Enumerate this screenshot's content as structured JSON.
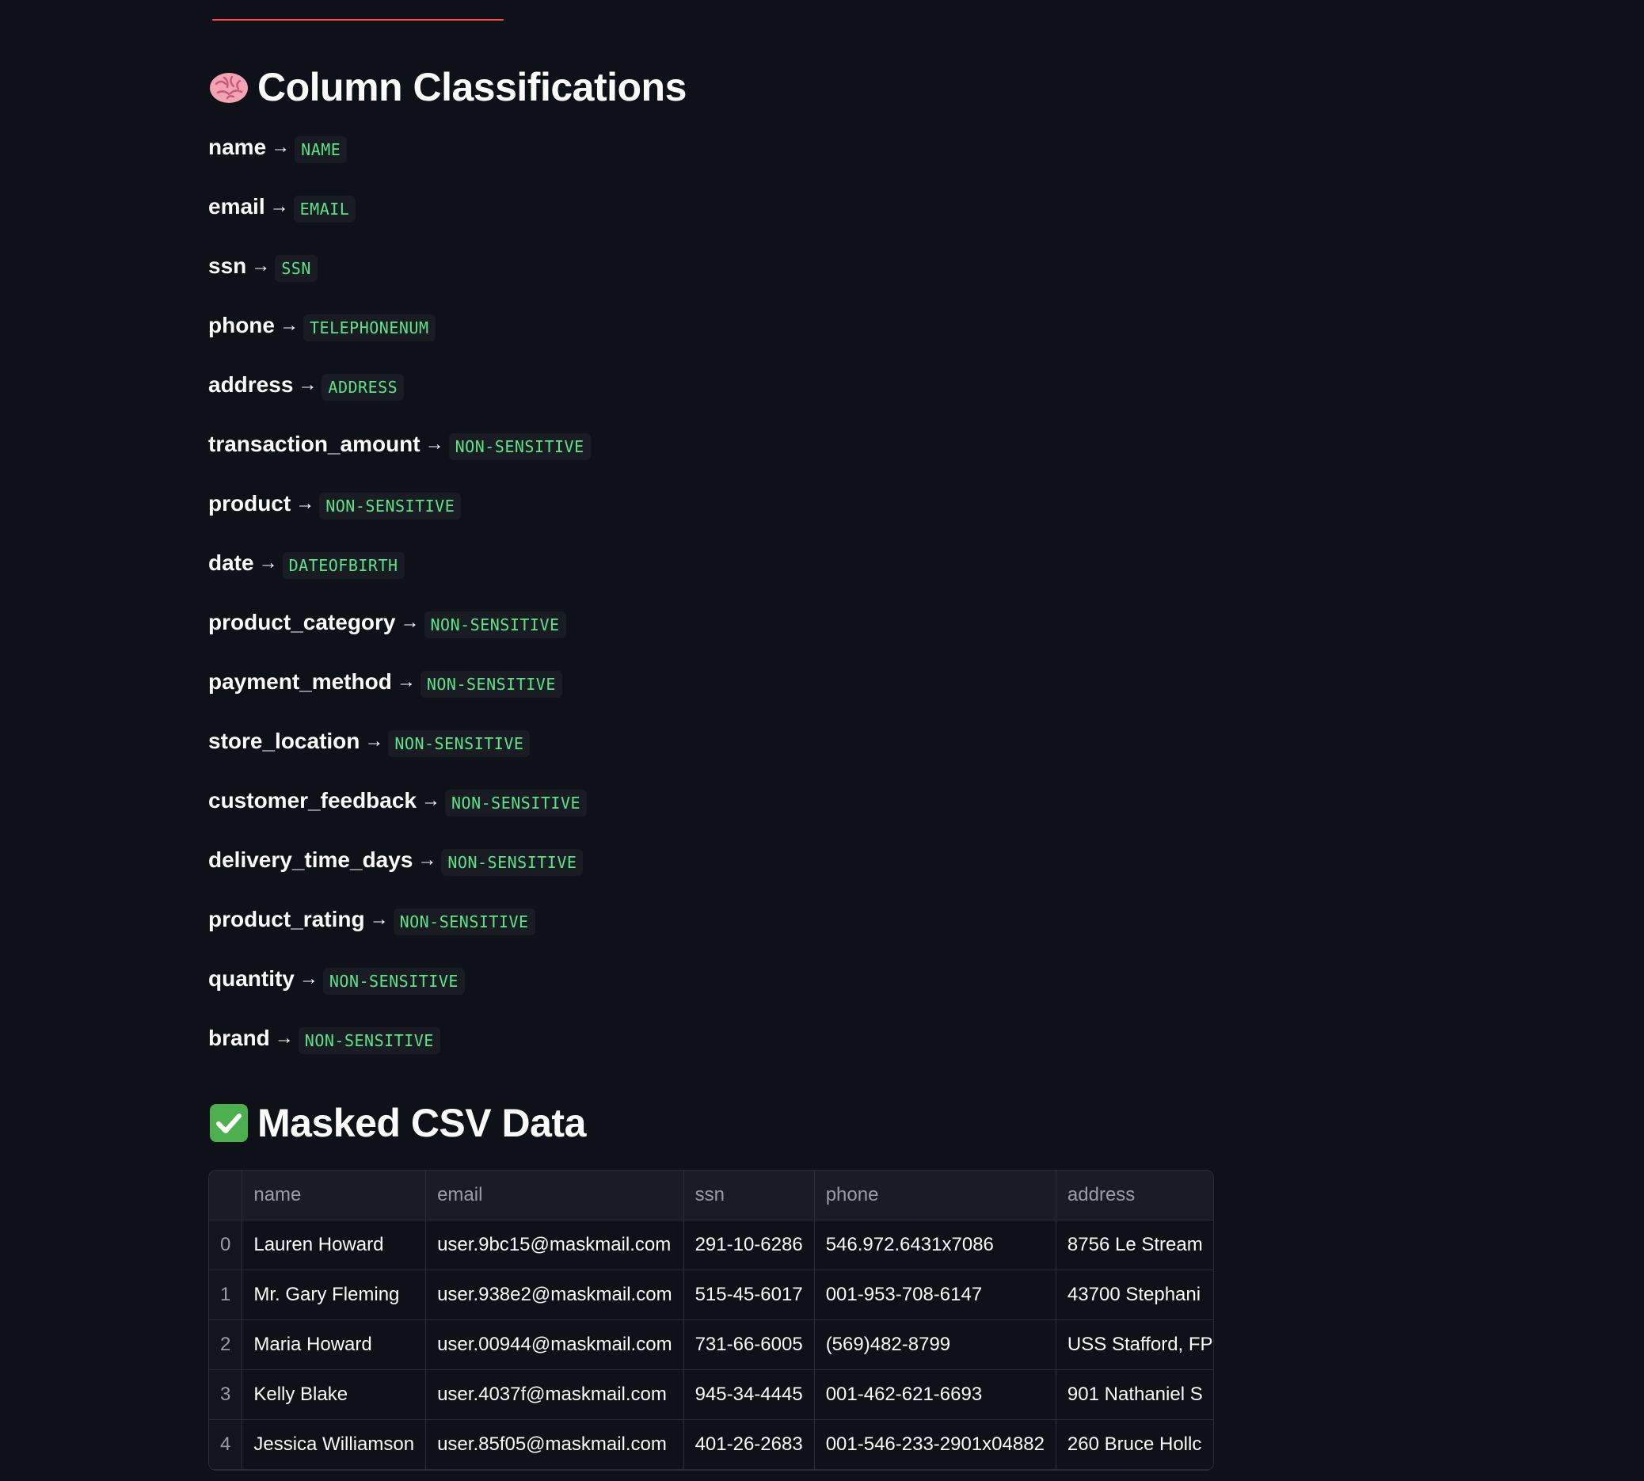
{
  "sections": {
    "classifications_title": "Column Classifications",
    "classifications_icon": "brain-icon",
    "masked_title": "Masked CSV Data",
    "masked_icon": "check-mark-icon"
  },
  "arrow_glyph": "→",
  "classifications": [
    {
      "column": "name",
      "label": "NAME"
    },
    {
      "column": "email",
      "label": "EMAIL"
    },
    {
      "column": "ssn",
      "label": "SSN"
    },
    {
      "column": "phone",
      "label": "TELEPHONENUM"
    },
    {
      "column": "address",
      "label": "ADDRESS"
    },
    {
      "column": "transaction_amount",
      "label": "NON-SENSITIVE"
    },
    {
      "column": "product",
      "label": "NON-SENSITIVE"
    },
    {
      "column": "date",
      "label": "DATEOFBIRTH"
    },
    {
      "column": "product_category",
      "label": "NON-SENSITIVE"
    },
    {
      "column": "payment_method",
      "label": "NON-SENSITIVE"
    },
    {
      "column": "store_location",
      "label": "NON-SENSITIVE"
    },
    {
      "column": "customer_feedback",
      "label": "NON-SENSITIVE"
    },
    {
      "column": "delivery_time_days",
      "label": "NON-SENSITIVE"
    },
    {
      "column": "product_rating",
      "label": "NON-SENSITIVE"
    },
    {
      "column": "quantity",
      "label": "NON-SENSITIVE"
    },
    {
      "column": "brand",
      "label": "NON-SENSITIVE"
    }
  ],
  "table": {
    "columns": [
      "",
      "name",
      "email",
      "ssn",
      "phone",
      "address"
    ],
    "rows": [
      [
        "0",
        "Lauren Howard",
        "user.9bc15@maskmail.com",
        "291-10-6286",
        "546.972.6431x7086",
        "8756 Le Stream"
      ],
      [
        "1",
        "Mr. Gary Fleming",
        "user.938e2@maskmail.com",
        "515-45-6017",
        "001-953-708-6147",
        "43700 Stephani"
      ],
      [
        "2",
        "Maria Howard",
        "user.00944@maskmail.com",
        "731-66-6005",
        "(569)482-8799",
        "USS Stafford, FP"
      ],
      [
        "3",
        "Kelly Blake",
        "user.4037f@maskmail.com",
        "945-34-4445",
        "001-462-621-6693",
        "901 Nathaniel S"
      ],
      [
        "4",
        "Jessica Williamson",
        "user.85f05@maskmail.com",
        "401-26-2683",
        "001-546-233-2901x04882",
        "260 Bruce Hollc"
      ]
    ]
  },
  "colors": {
    "background": "#0e1117",
    "tag_text": "#5ce488",
    "tag_bg": "#1a1c24",
    "accent": "#ff4b4b"
  }
}
